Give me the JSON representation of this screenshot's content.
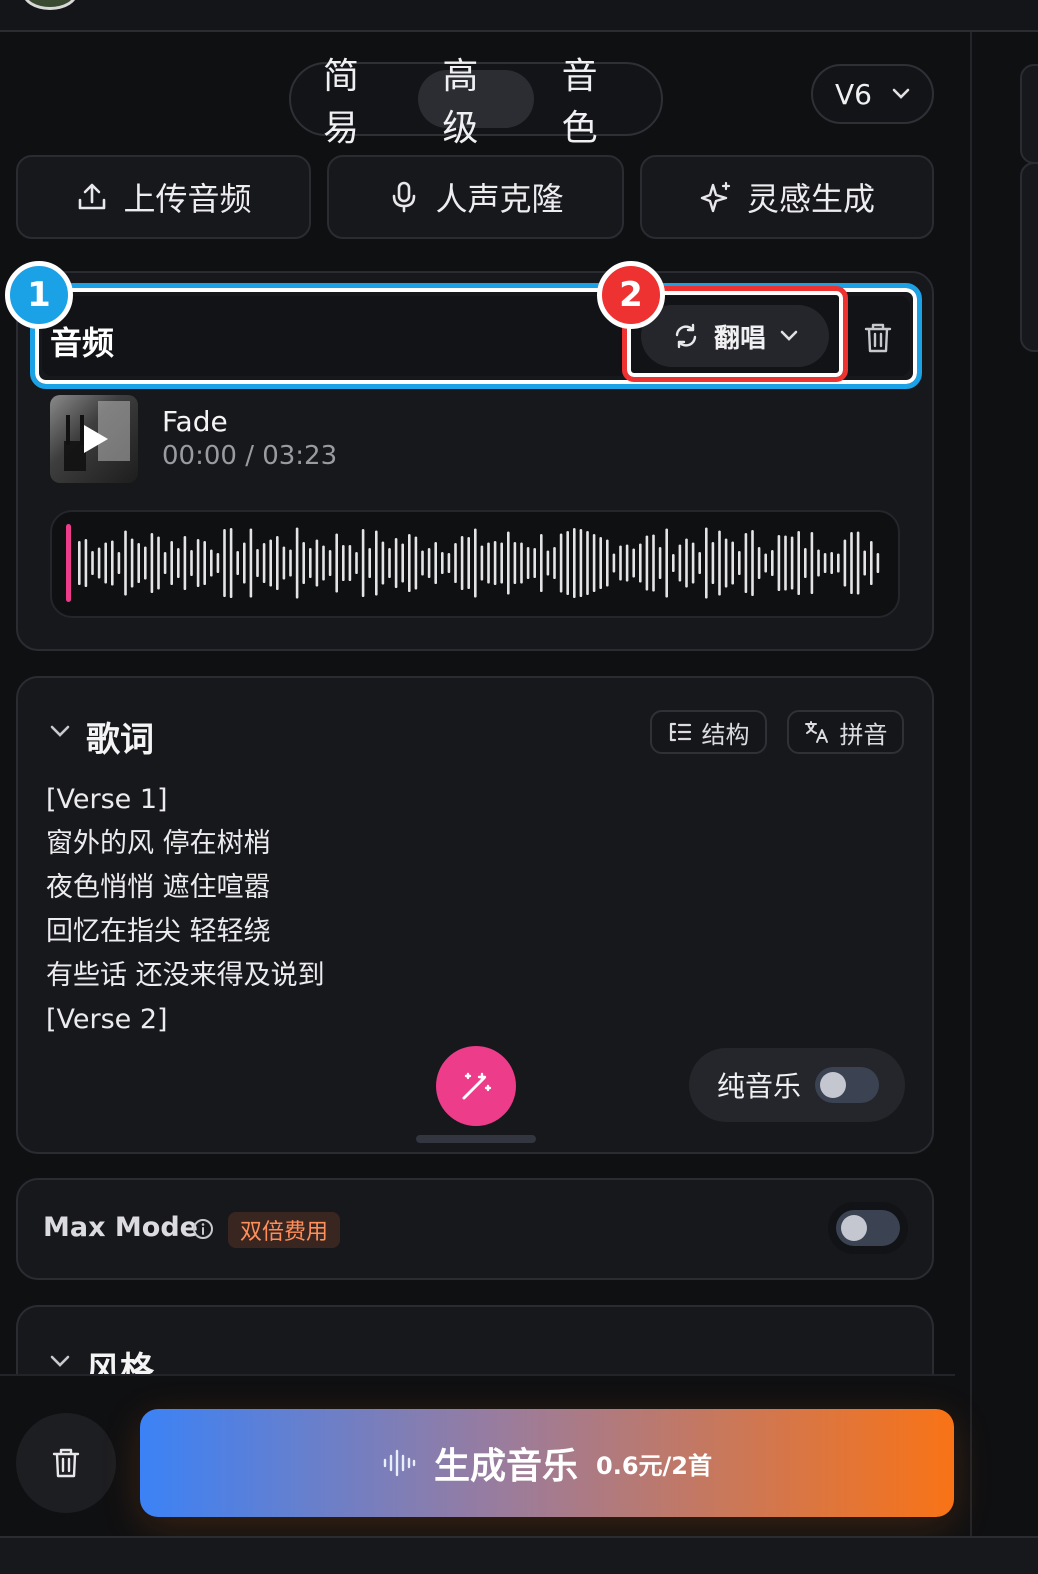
{
  "modes": [
    {
      "label": "简易",
      "active": false
    },
    {
      "label": "高级",
      "active": true
    },
    {
      "label": "音色",
      "active": false
    }
  ],
  "version": {
    "label": "V6"
  },
  "actions": {
    "upload": "上传音频",
    "voice_clone": "人声克隆",
    "inspiration": "灵感生成"
  },
  "audio": {
    "title": "音频",
    "cover_mode": "翻唱",
    "track_name": "Fade",
    "time": "00:00 / 03:23",
    "progress": 0.0
  },
  "annotations": {
    "badge1": "1",
    "badge2": "2"
  },
  "lyrics": {
    "title": "歌词",
    "structure_label": "结构",
    "pinyin_label": "拼音",
    "lines": [
      "[Verse 1]",
      "窗外的风 停在树梢",
      "夜色悄悄 遮住喧嚣",
      "回忆在指尖 轻轻绕",
      "有些话 还没来得及说到",
      "[Verse 2]"
    ],
    "instrumental_label": "纯音乐",
    "instrumental_on": false
  },
  "max_mode": {
    "label": "Max Mode",
    "badge": "双倍费用",
    "enabled": false
  },
  "style": {
    "title": "风格"
  },
  "generate": {
    "label": "生成音乐",
    "price": "0.6元/2首"
  },
  "colors": {
    "accent_blue": "#1aa1e6",
    "accent_red": "#ee3131",
    "accent_pink": "#ec3c8a",
    "gradient_start": "#3b82f6",
    "gradient_end": "#f97316"
  }
}
